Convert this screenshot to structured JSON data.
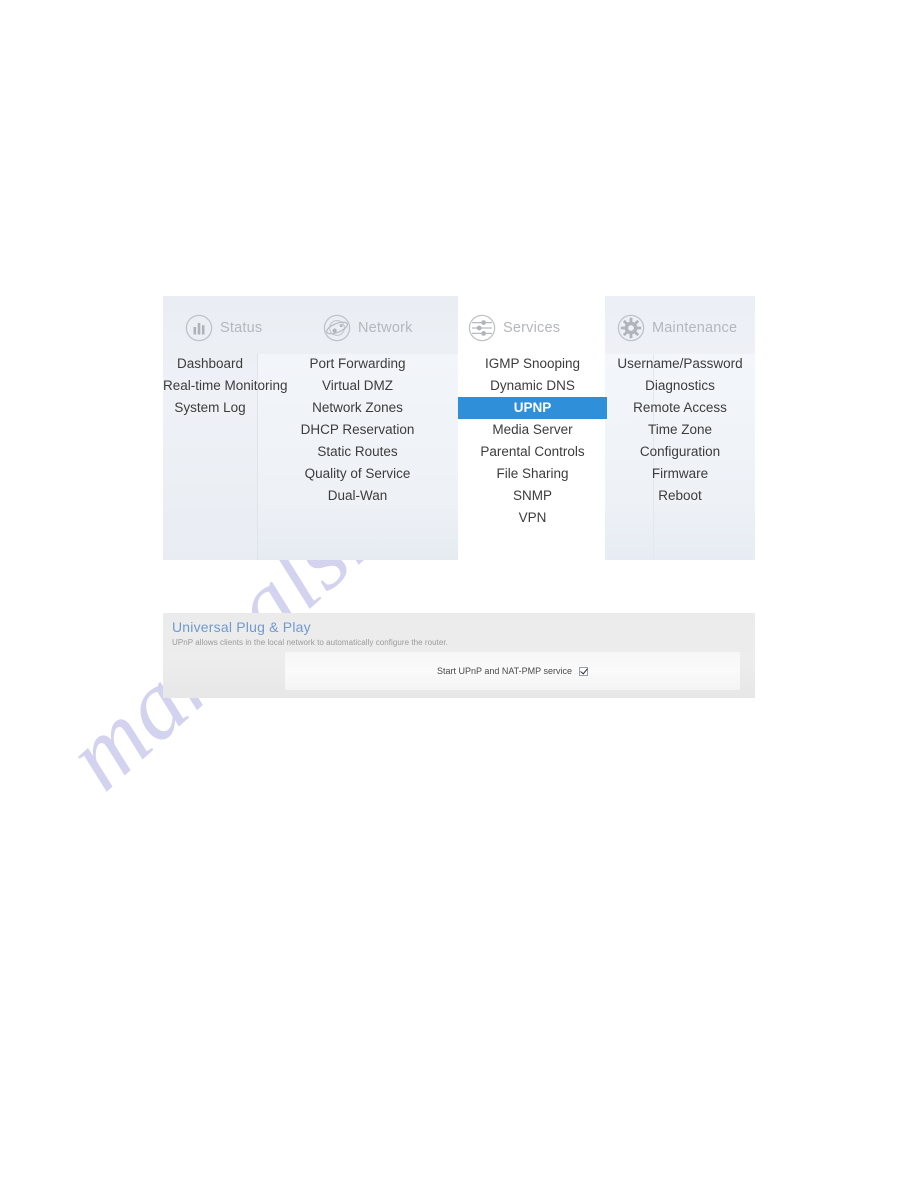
{
  "menu": {
    "categories": [
      {
        "id": "status",
        "label": "Status",
        "icon": "bar-chart-icon",
        "items": [
          {
            "label": "Dashboard",
            "active": false
          },
          {
            "label": "Real-time Monitoring",
            "active": false
          },
          {
            "label": "System Log",
            "active": false
          }
        ]
      },
      {
        "id": "network",
        "label": "Network",
        "icon": "globe-orbit-icon",
        "items": [
          {
            "label": "Port Forwarding",
            "active": false
          },
          {
            "label": "Virtual DMZ",
            "active": false
          },
          {
            "label": "Network Zones",
            "active": false
          },
          {
            "label": "DHCP Reservation",
            "active": false
          },
          {
            "label": "Static Routes",
            "active": false
          },
          {
            "label": "Quality of Service",
            "active": false
          },
          {
            "label": "Dual-Wan",
            "active": false
          }
        ]
      },
      {
        "id": "services",
        "label": "Services",
        "icon": "sliders-icon",
        "items": [
          {
            "label": "IGMP Snooping",
            "active": false
          },
          {
            "label": "Dynamic DNS",
            "active": false
          },
          {
            "label": "UPNP",
            "active": true
          },
          {
            "label": "Media Server",
            "active": false
          },
          {
            "label": "Parental Controls",
            "active": false
          },
          {
            "label": "File Sharing",
            "active": false
          },
          {
            "label": "SNMP",
            "active": false
          },
          {
            "label": "VPN",
            "active": false
          }
        ]
      },
      {
        "id": "maintenance",
        "label": "Maintenance",
        "icon": "gear-icon",
        "items": [
          {
            "label": "Username/Password",
            "active": false
          },
          {
            "label": "Diagnostics",
            "active": false
          },
          {
            "label": "Remote Access",
            "active": false
          },
          {
            "label": "Time Zone",
            "active": false
          },
          {
            "label": "Configuration",
            "active": false
          },
          {
            "label": "Firmware",
            "active": false
          },
          {
            "label": "Reboot",
            "active": false
          }
        ]
      }
    ]
  },
  "content": {
    "title": "Universal Plug & Play",
    "subtitle": "UPnP allows clients in the local network to automatically configure the router.",
    "field_label": "Start UPnP and NAT-PMP service",
    "field_checked": true
  },
  "watermark": {
    "text": "manualshive.com"
  },
  "colors": {
    "active_item_bg": "#2f8fd8",
    "active_item_text": "#ffffff",
    "card_title": "#6f9ad0",
    "category_label": "#b4b7bd",
    "menu_text": "#3c3c3c",
    "watermark": "#b9b9e8"
  }
}
